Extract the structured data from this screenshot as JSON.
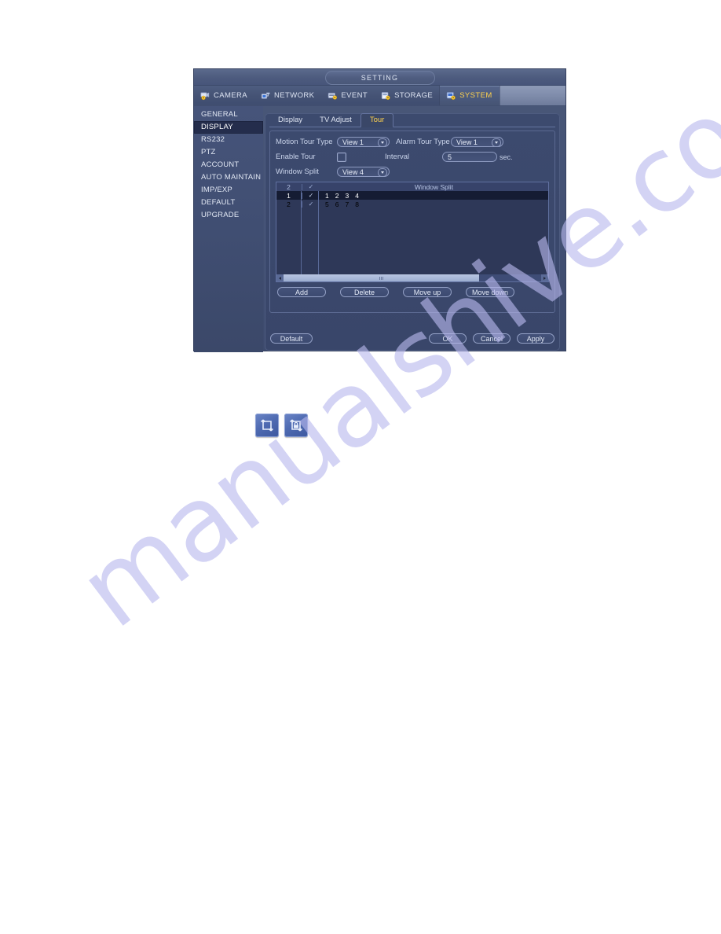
{
  "window": {
    "title": "SETTING"
  },
  "top_nav": {
    "items": [
      {
        "label": "CAMERA",
        "icon": "camera-gear-icon",
        "active": false
      },
      {
        "label": "NETWORK",
        "icon": "network-icon",
        "active": false
      },
      {
        "label": "EVENT",
        "icon": "event-icon",
        "active": false
      },
      {
        "label": "STORAGE",
        "icon": "storage-icon",
        "active": false
      },
      {
        "label": "SYSTEM",
        "icon": "system-gear-icon",
        "active": true
      }
    ]
  },
  "sidebar": {
    "items": [
      {
        "label": "GENERAL",
        "active": false
      },
      {
        "label": "DISPLAY",
        "active": true
      },
      {
        "label": "RS232",
        "active": false
      },
      {
        "label": "PTZ",
        "active": false
      },
      {
        "label": "ACCOUNT",
        "active": false
      },
      {
        "label": "AUTO MAINTAIN",
        "active": false
      },
      {
        "label": "IMP/EXP",
        "active": false
      },
      {
        "label": "DEFAULT",
        "active": false
      },
      {
        "label": "UPGRADE",
        "active": false
      }
    ]
  },
  "sub_tabs": [
    {
      "label": "Display",
      "active": false
    },
    {
      "label": "TV Adjust",
      "active": false
    },
    {
      "label": "Tour",
      "active": true
    }
  ],
  "form": {
    "motion_tour_type": {
      "label": "Motion Tour Type",
      "value": "View 1"
    },
    "alarm_tour_type": {
      "label": "Alarm Tour Type",
      "value": "View 1"
    },
    "enable_tour": {
      "label": "Enable Tour",
      "checked": false
    },
    "interval": {
      "label": "Interval",
      "value": "5",
      "unit": "sec."
    },
    "window_split": {
      "label": "Window Split",
      "value": "View 4"
    }
  },
  "table": {
    "header": {
      "index": "2",
      "checked": true,
      "title": "Window Split"
    },
    "rows": [
      {
        "index": "1",
        "checked": true,
        "channels": [
          "1",
          "2",
          "3",
          "4"
        ],
        "selected": true
      },
      {
        "index": "2",
        "checked": true,
        "channels": [
          "5",
          "6",
          "7",
          "8"
        ],
        "selected": false
      }
    ],
    "check_glyph": "✓"
  },
  "scrollbar": {
    "left_arrow": "◄",
    "right_arrow": "►",
    "thumb_percent": 76
  },
  "list_buttons": [
    {
      "label": "Add"
    },
    {
      "label": "Delete"
    },
    {
      "label": "Move up"
    },
    {
      "label": "Move down"
    }
  ],
  "bottom_buttons": {
    "default": "Default",
    "ok": "OK",
    "cancel": "Cancel",
    "apply": "Apply"
  },
  "tour_icons": [
    {
      "name": "tour-enable-icon"
    },
    {
      "name": "tour-lock-icon"
    }
  ],
  "watermark": {
    "text": "manualshive.com"
  },
  "colors": {
    "accent_yellow": "#ffd24d",
    "window_bg": "#445275",
    "panel_bg": "#3b4869",
    "table_bg": "#2e3858",
    "row_selected": "#151c33",
    "sidebar_selected": "#242d4c",
    "watermark": "#b9b9ee"
  }
}
